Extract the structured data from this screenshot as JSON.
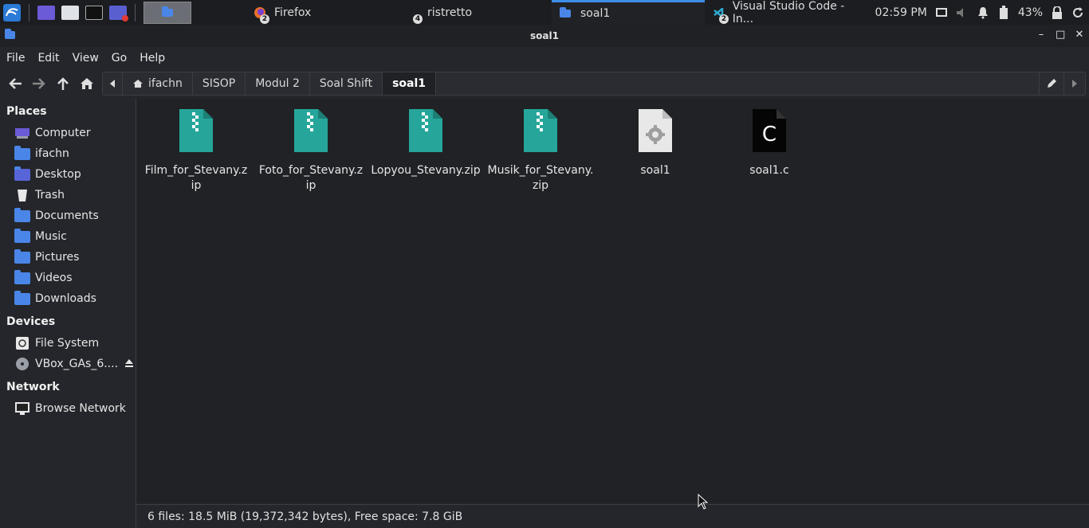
{
  "panel": {
    "tasks": [
      {
        "label": "Firefox",
        "badge": "2"
      },
      {
        "label": "ristretto",
        "badge": "4"
      },
      {
        "label": "soal1",
        "badge": ""
      },
      {
        "label": "Visual Studio Code - In...",
        "badge": "2"
      }
    ],
    "clock": "02:59 PM",
    "battery": "43%"
  },
  "window": {
    "title": "soal1"
  },
  "menu": [
    "File",
    "Edit",
    "View",
    "Go",
    "Help"
  ],
  "breadcrumbs": [
    "ifachn",
    "SISOP",
    "Modul 2",
    "Soal Shift",
    "soal1"
  ],
  "sidebar": {
    "places_heading": "Places",
    "places": [
      "Computer",
      "ifachn",
      "Desktop",
      "Trash",
      "Documents",
      "Music",
      "Pictures",
      "Videos",
      "Downloads"
    ],
    "devices_heading": "Devices",
    "devices": [
      "File System",
      "VBox_GAs_6...."
    ],
    "network_heading": "Network",
    "network": [
      "Browse Network"
    ]
  },
  "files": [
    {
      "name": "Film_for_Stevany.zip",
      "type": "zip"
    },
    {
      "name": "Foto_for_Stevany.zip",
      "type": "zip"
    },
    {
      "name": "Lopyou_Stevany.zip",
      "type": "zip"
    },
    {
      "name": "Musik_for_Stevany.zip",
      "type": "zip"
    },
    {
      "name": "soal1",
      "type": "executable"
    },
    {
      "name": "soal1.c",
      "type": "c-source"
    }
  ],
  "status": "6 files: 18.5 MiB (19,372,342 bytes), Free space: 7.8 GiB",
  "colors": {
    "accent": "#3d8ee8",
    "folder": "#4a86e8",
    "zip": "#26a69a"
  }
}
